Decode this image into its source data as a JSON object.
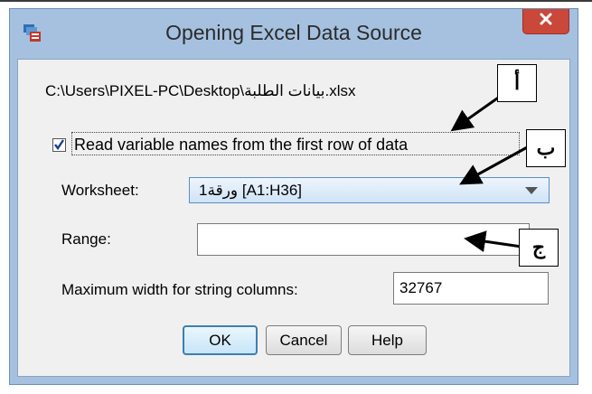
{
  "dialog": {
    "title": "Opening Excel Data Source",
    "close_glyph": "✕",
    "file_path": "C:\\Users\\PIXEL-PC\\Desktop\\بيانات الطلبة.xlsx",
    "checkbox_label": "Read variable names from the first row of data",
    "checkbox_checked": true,
    "worksheet_label": "Worksheet:",
    "worksheet_value": "ورقة1 [A1:H36]",
    "range_label": "Range:",
    "range_value": "",
    "maxwidth_label": "Maximum width for string columns:",
    "maxwidth_value": "32767",
    "buttons": {
      "ok": "OK",
      "cancel": "Cancel",
      "help": "Help"
    }
  },
  "annotations": {
    "a": "أ",
    "b": "ب",
    "c": "ج"
  },
  "colors": {
    "frame": "#a5c1df",
    "close": "#c9483a",
    "client": "#f0f0f0"
  }
}
